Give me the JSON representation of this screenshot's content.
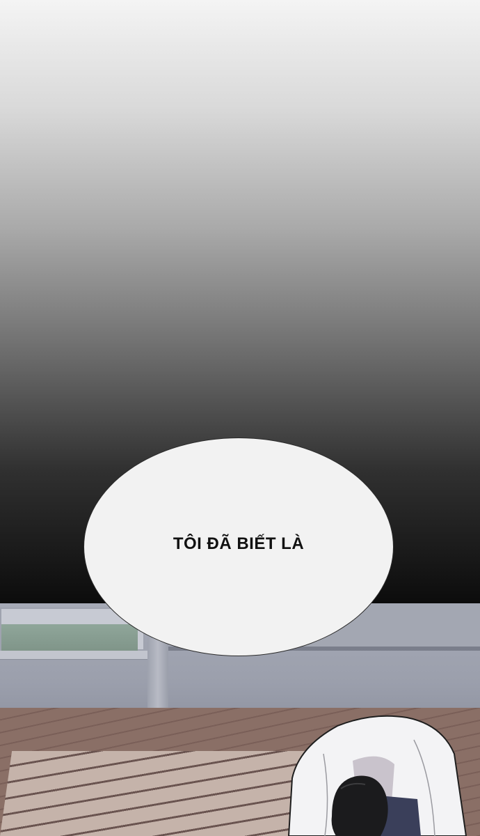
{
  "panel": {
    "speech_bubble": {
      "text": "TÔI ĐÃ BIẾT LÀ"
    }
  },
  "colors": {
    "sky_top": "#f4f4f4",
    "sky_bottom": "#0c0c0c",
    "bubble_fill": "#f2f2f2",
    "text": "#111111"
  }
}
